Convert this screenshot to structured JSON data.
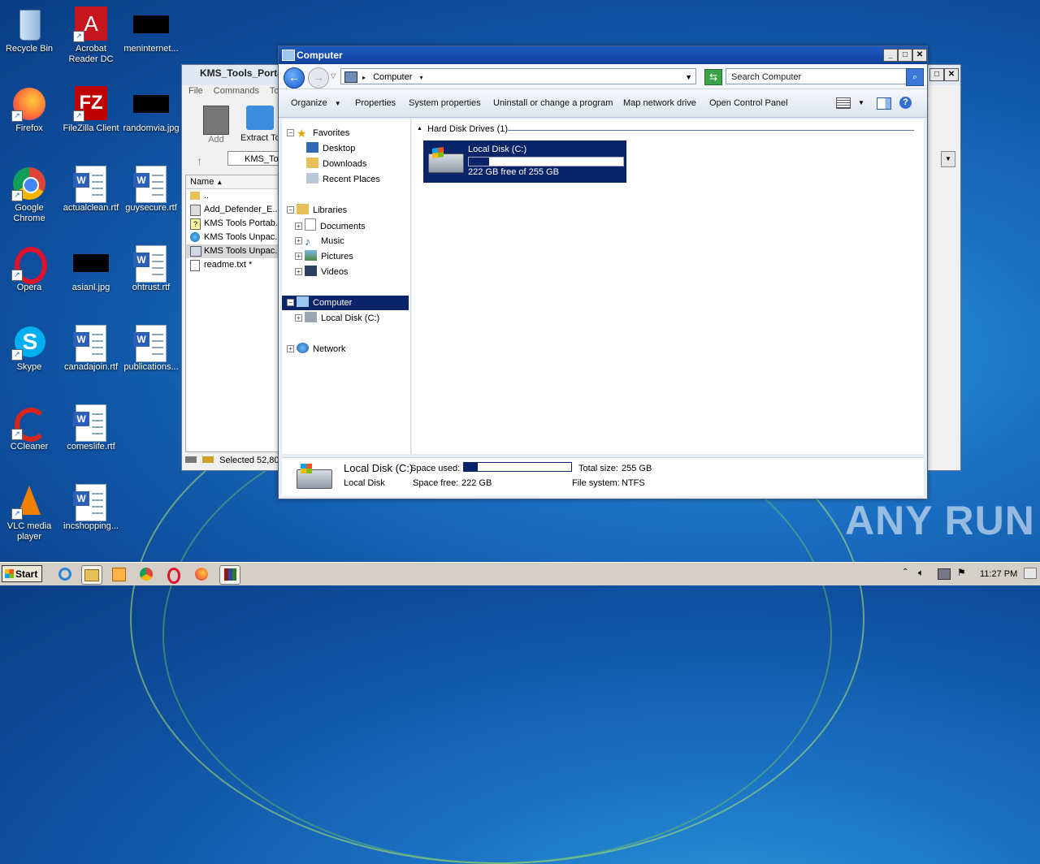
{
  "colors": {
    "titlebar": "#1f5bc2",
    "selection": "#0a246a",
    "diskbar": "#0a246a"
  },
  "desktop": {
    "icons": [
      {
        "label": "Recycle Bin",
        "icon": "recycle-bin-icon"
      },
      {
        "label": "Acrobat Reader DC",
        "icon": "acrobat-icon"
      },
      {
        "label": "meninternet...",
        "icon": "redacted-image-icon"
      },
      {
        "label": "Firefox",
        "icon": "firefox-icon"
      },
      {
        "label": "FileZilla Client",
        "icon": "filezilla-icon"
      },
      {
        "label": "randomvia.jpg",
        "icon": "redacted-image-icon"
      },
      {
        "label": "Google Chrome",
        "icon": "chrome-icon"
      },
      {
        "label": "actualclean.rtf",
        "icon": "word-doc-icon"
      },
      {
        "label": "guysecure.rtf",
        "icon": "word-doc-icon"
      },
      {
        "label": "Opera",
        "icon": "opera-icon"
      },
      {
        "label": "asianl.jpg",
        "icon": "redacted-image-icon"
      },
      {
        "label": "ohtrust.rtf",
        "icon": "word-doc-icon"
      },
      {
        "label": "Skype",
        "icon": "skype-icon"
      },
      {
        "label": "canadajoin.rtf",
        "icon": "word-doc-icon"
      },
      {
        "label": "publications...",
        "icon": "word-doc-icon"
      },
      {
        "label": "CCleaner",
        "icon": "ccleaner-icon"
      },
      {
        "label": "comeslife.rtf",
        "icon": "word-doc-icon"
      },
      {
        "label": "VLC media player",
        "icon": "vlc-icon"
      },
      {
        "label": "incshopping...",
        "icon": "word-doc-icon"
      }
    ]
  },
  "winrar": {
    "title": "KMS_Tools_Porta",
    "menu": [
      "File",
      "Commands",
      "Too"
    ],
    "toolbar": [
      "Add",
      "Extract To"
    ],
    "path": "KMS_Too",
    "column": "Name",
    "files": [
      "..",
      "Add_Defender_E...",
      "KMS Tools Portab...",
      "KMS Tools Unpac...",
      "KMS Tools Unpac...",
      "readme.txt *"
    ],
    "status": "Selected 52,80"
  },
  "explorer": {
    "title": "Computer",
    "address": "Computer",
    "search_placeholder": "Search Computer",
    "commands": [
      "Organize",
      "Properties",
      "System properties",
      "Uninstall or change a program",
      "Map network drive",
      "Open Control Panel"
    ],
    "nav": {
      "favorites": "Favorites",
      "desktop": "Desktop",
      "downloads": "Downloads",
      "recent": "Recent Places",
      "libraries": "Libraries",
      "documents": "Documents",
      "music": "Music",
      "pictures": "Pictures",
      "videos": "Videos",
      "computer": "Computer",
      "localdisk": "Local Disk (C:)",
      "network": "Network"
    },
    "group_header": "Hard Disk Drives (1)",
    "drive": {
      "name": "Local Disk (C:)",
      "free_text": "222 GB free of 255 GB",
      "used_fraction": 0.13
    },
    "details": {
      "name": "Local Disk (C:)",
      "type": "Local Disk",
      "space_used_label": "Space used:",
      "space_free_label": "Space free:",
      "space_free": "222 GB",
      "total_label": "Total size:",
      "total": "255 GB",
      "fs_label": "File system:",
      "fs": "NTFS"
    }
  },
  "taskbar": {
    "start": "Start",
    "clock": "11:27 PM"
  },
  "watermark": "ANY RUN"
}
